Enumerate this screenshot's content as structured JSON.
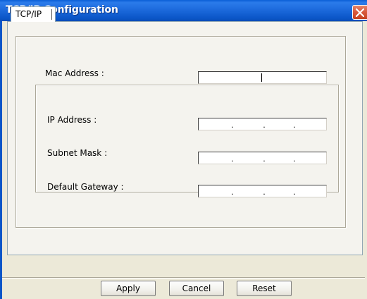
{
  "window": {
    "title": "TCP/IP Configuration",
    "close_icon": "close-icon"
  },
  "tabs": [
    {
      "label": "TCP/IP",
      "selected": true
    }
  ],
  "fields": {
    "mac_address": {
      "label": "Mac Address :",
      "value": ""
    },
    "ip_address": {
      "label": "IP Address :",
      "value": "",
      "separators": [
        ".",
        ".",
        "."
      ]
    },
    "subnet_mask": {
      "label": "Subnet Mask :",
      "value": "",
      "separators": [
        ".",
        ".",
        "."
      ]
    },
    "default_gateway": {
      "label": "Default Gateway :",
      "value": "",
      "separators": [
        ".",
        ".",
        "."
      ]
    }
  },
  "buttons": {
    "apply": "Apply",
    "cancel": "Cancel",
    "reset": "Reset"
  },
  "colors": {
    "titlebar": "#0b56c8",
    "close_button": "#d95b3f",
    "dialog_bg": "#ece9d8"
  }
}
